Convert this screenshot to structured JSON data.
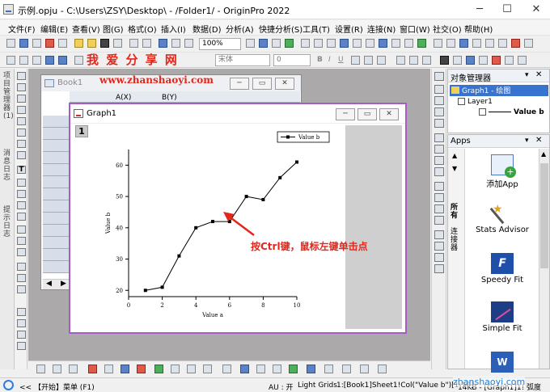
{
  "window": {
    "title": "示例.opju - C:\\Users\\ZSY\\Desktop\\ - /Folder1/ - OriginPro 2022"
  },
  "menu": [
    "文件(F)",
    "编辑(E)",
    "查看(V)",
    "图(G)",
    "格式(O)",
    "插入(I)",
    "数据(D)",
    "分析(A)",
    "快捷分析(S)",
    "工具(T)",
    "设置(R)",
    "连接(N)",
    "窗口(W)",
    "社交(O)",
    "帮助(H)"
  ],
  "toolbar": {
    "zoom": "100%",
    "font": "宋体",
    "font_size": "0"
  },
  "watermark": {
    "site_cn": "我 爱 分 享 网",
    "site_url": "www.zhanshaoyi.com",
    "corner_url": "zhanshaoyi.com"
  },
  "left_tabs": [
    "项目管理器(1)",
    "消息日志",
    "提示日志"
  ],
  "book1": {
    "title": "Book1",
    "col_a": "A(X)",
    "col_b": "B(Y)"
  },
  "graph1": {
    "title": "Graph1",
    "layer": "1"
  },
  "annotation": "按Ctrl键，鼠标左键单击点",
  "chart_data": {
    "type": "line",
    "x": [
      1,
      2,
      3,
      4,
      5,
      6,
      7,
      8,
      9,
      10
    ],
    "series": [
      {
        "name": "Value b",
        "values": [
          20,
          21,
          31,
          40,
          42,
          42,
          50,
          49,
          56,
          61
        ]
      }
    ],
    "xlabel": "Value a",
    "ylabel": "Value b",
    "xlim": [
      0,
      10
    ],
    "ylim": [
      18,
      65
    ],
    "xticks": [
      "0",
      "2",
      "4",
      "6",
      "8",
      "10"
    ],
    "yticks": [
      "20",
      "30",
      "40",
      "50",
      "60"
    ],
    "legend": "top-right",
    "grid": false
  },
  "object_manager": {
    "title": "对象管理器",
    "graph_node": "Graph1 - 绘图",
    "layer_node": "Layer1",
    "plot_node": "Value b"
  },
  "apps": {
    "title": "Apps",
    "side_tabs": [
      "所有",
      "连接器"
    ],
    "items": [
      {
        "label": "添加App",
        "icon": "add-app-icon"
      },
      {
        "label": "Stats Advisor",
        "icon": "wand-icon"
      },
      {
        "label": "Speedy Fit",
        "icon": "speedy-fit-icon"
      },
      {
        "label": "Simple Fit",
        "icon": "simple-fit-icon"
      }
    ]
  },
  "status": {
    "start": "<< 【开始】菜单 (F1)",
    "au": "AU : 开",
    "grids": "Light Grids",
    "ref": "1:[Book1]Sheet1!Col(\"Value b\")[1:10]",
    "mem": "14KB - [Graph1]1! 弧度"
  },
  "colors": {
    "graph_border": "#a75cc4",
    "watermark": "#e4261b",
    "selected_tree": "#3873d0"
  }
}
